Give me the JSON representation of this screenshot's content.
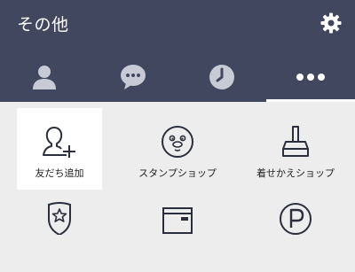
{
  "header": {
    "title": "その他",
    "background": "#40475e",
    "tabs": [
      {
        "name": "friends",
        "icon": "person-icon"
      },
      {
        "name": "chats",
        "icon": "chat-bubble-icon"
      },
      {
        "name": "timeline",
        "icon": "clock-icon"
      },
      {
        "name": "more",
        "icon": "more-dots-icon",
        "selected": true
      }
    ]
  },
  "menu": {
    "items": [
      {
        "label": "友だち追加",
        "icon": "add-friend-icon",
        "active": true
      },
      {
        "label": "スタンプショップ",
        "icon": "sticker-shop-icon"
      },
      {
        "label": "着せかえショップ",
        "icon": "theme-shop-icon"
      },
      {
        "label": "",
        "icon": "shield-star-icon"
      },
      {
        "label": "",
        "icon": "wallet-card-icon"
      },
      {
        "label": "",
        "icon": "p-coin-icon"
      }
    ]
  },
  "colors": {
    "icon_dark": "#2b2f3d",
    "tab_icon": "#c8cbd6",
    "tab_selected": "#ffffff"
  }
}
